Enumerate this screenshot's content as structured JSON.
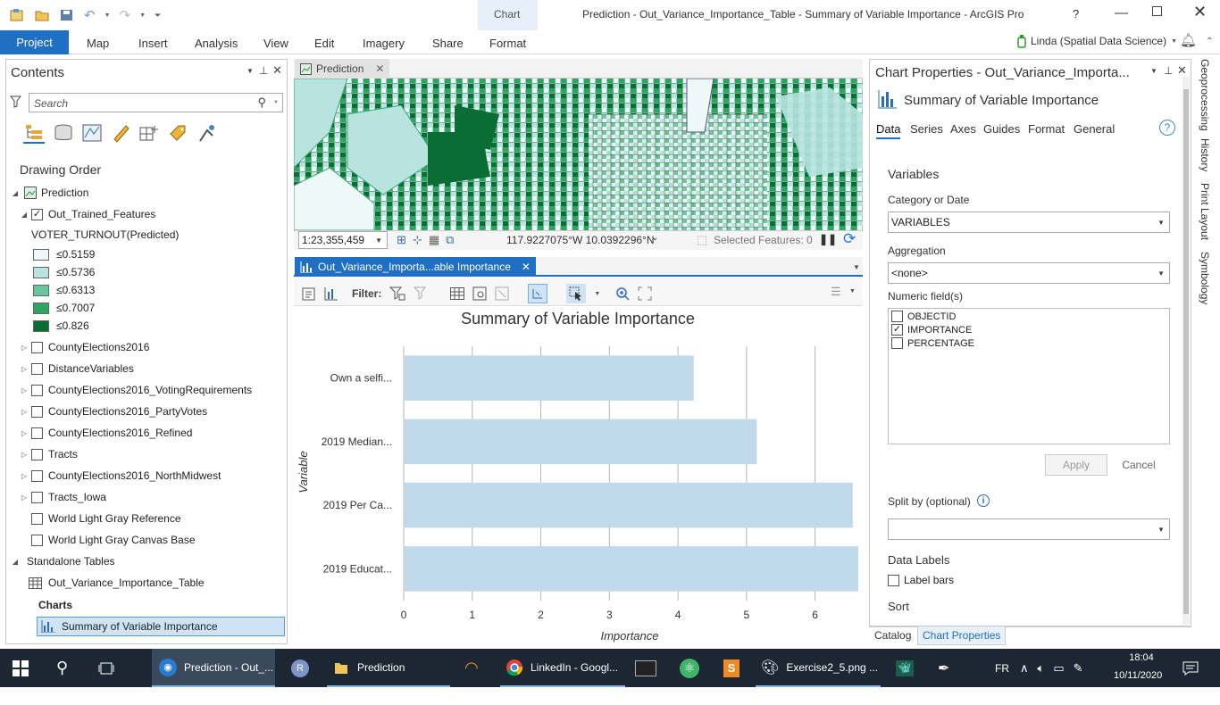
{
  "window": {
    "title": "Prediction - Out_Variance_Importance_Table - Summary of Variable Importance - ArcGIS Pro",
    "help": "?",
    "user": "Linda (Spatial Data Science)"
  },
  "ribbon": {
    "context_group": "Chart",
    "tabs": [
      "Project",
      "Map",
      "Insert",
      "Analysis",
      "View",
      "Edit",
      "Imagery",
      "Share",
      "Format"
    ]
  },
  "contents": {
    "title": "Contents",
    "search_placeholder": "Search",
    "drawing_order": "Drawing Order",
    "map_name": "Prediction",
    "layer_main": "Out_Trained_Features",
    "legend_title": "VOTER_TURNOUT(Predicted)",
    "legend": [
      {
        "label": "≤0.5159",
        "color": "#eef8f8"
      },
      {
        "label": "≤0.5736",
        "color": "#b8e3df"
      },
      {
        "label": "≤0.6313",
        "color": "#6cc49e"
      },
      {
        "label": "≤0.7007",
        "color": "#2ea463"
      },
      {
        "label": "≤0.826",
        "color": "#0a6e34"
      }
    ],
    "layers": [
      "CountyElections2016",
      "DistanceVariables",
      "CountyElections2016_VotingRequirements",
      "CountyElections2016_PartyVotes",
      "CountyElections2016_Refined",
      "Tracts",
      "CountyElections2016_NorthMidwest",
      "Tracts_Iowa"
    ],
    "basemaps": [
      "World Light Gray Reference",
      "World Light Gray Canvas Base"
    ],
    "standalone_tables": "Standalone Tables",
    "table_name": "Out_Variance_Importance_Table",
    "charts_label": "Charts",
    "chart_item": "Summary of Variable Importance"
  },
  "map_view": {
    "tab": "Prediction",
    "scale": "1:23,355,459",
    "coords": "117.9227075°W 10.0392296°N",
    "selected": "Selected Features: 0"
  },
  "chart_view": {
    "tab": "Out_Variance_Importa...able Importance",
    "filter_label": "Filter:"
  },
  "chart_data": {
    "type": "bar",
    "orientation": "horizontal",
    "title": "Summary of Variable Importance",
    "xlabel": "Importance",
    "ylabel": "Variable",
    "categories": [
      "Own a selfi...",
      "2019 Median...",
      "2019 Per Ca...",
      "2019 Educat..."
    ],
    "values": [
      4.23,
      5.15,
      6.55,
      6.63
    ],
    "xlim": [
      0,
      6.63
    ],
    "xticks": [
      0,
      1,
      2,
      3,
      4,
      5,
      6
    ],
    "grid": true,
    "bar_color": "#c0daeb"
  },
  "properties": {
    "title": "Chart Properties - Out_Variance_Importa...",
    "chart_name": "Summary of Variable Importance",
    "tabs": [
      "Data",
      "Series",
      "Axes",
      "Guides",
      "Format",
      "General"
    ],
    "variables_heading": "Variables",
    "category_label": "Category or Date",
    "category_value": "VARIABLES",
    "aggregation_label": "Aggregation",
    "aggregation_value": "<none>",
    "numeric_label": "Numeric field(s)",
    "fields": [
      {
        "name": "OBJECTID",
        "checked": false
      },
      {
        "name": "IMPORTANCE",
        "checked": true
      },
      {
        "name": "PERCENTAGE",
        "checked": false
      }
    ],
    "apply": "Apply",
    "cancel": "Cancel",
    "split_label": "Split by (optional)",
    "data_labels_heading": "Data Labels",
    "label_bars": "Label bars",
    "sort_heading": "Sort",
    "bottom_tabs": [
      "Catalog",
      "Chart Properties"
    ]
  },
  "side_tabs": [
    "Geoprocessing",
    "History",
    "Print Layout",
    "Symbology"
  ],
  "taskbar": {
    "items": [
      "Prediction - Out_...",
      "Prediction",
      "LinkedIn - Googl...",
      "Exercise2_5.png ..."
    ],
    "lang": "FR",
    "time": "18:04",
    "date": "10/11/2020"
  }
}
